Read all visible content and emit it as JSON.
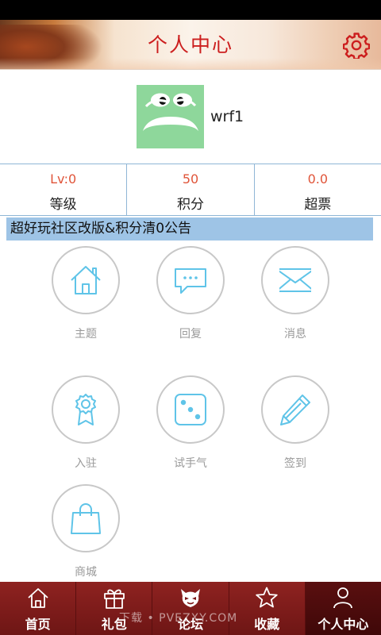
{
  "header": {
    "title": "个人中心",
    "settings_icon": "gear-icon",
    "accent": "#cc1e1e"
  },
  "profile": {
    "username": "wrf1",
    "avatar_icon": "frog-face-avatar"
  },
  "stats": [
    {
      "value": "Lv:0",
      "label": "等级"
    },
    {
      "value": "50",
      "label": "积分"
    },
    {
      "value": "0.0",
      "label": "超票"
    }
  ],
  "notice": {
    "text": "超好玩社区改版&积分清0公告"
  },
  "menu": [
    {
      "label": "主题",
      "icon": "house-icon"
    },
    {
      "label": "回复",
      "icon": "chat-bubble-icon"
    },
    {
      "label": "消息",
      "icon": "envelope-icon"
    },
    {
      "label": "入驻",
      "icon": "badge-ribbon-icon"
    },
    {
      "label": "试手气",
      "icon": "dice-icon"
    },
    {
      "label": "签到",
      "icon": "pencil-icon"
    },
    {
      "label": "商城",
      "icon": "shopping-bag-icon"
    }
  ],
  "tabs": [
    {
      "label": "首页",
      "icon": "home-outline-icon"
    },
    {
      "label": "礼包",
      "icon": "gift-icon"
    },
    {
      "label": "论坛",
      "icon": "forum-mascot-icon"
    },
    {
      "label": "收藏",
      "icon": "star-icon"
    },
    {
      "label": "个人中心",
      "icon": "person-icon",
      "active": true
    }
  ],
  "watermark": "下载 • PVEZXY.COM"
}
